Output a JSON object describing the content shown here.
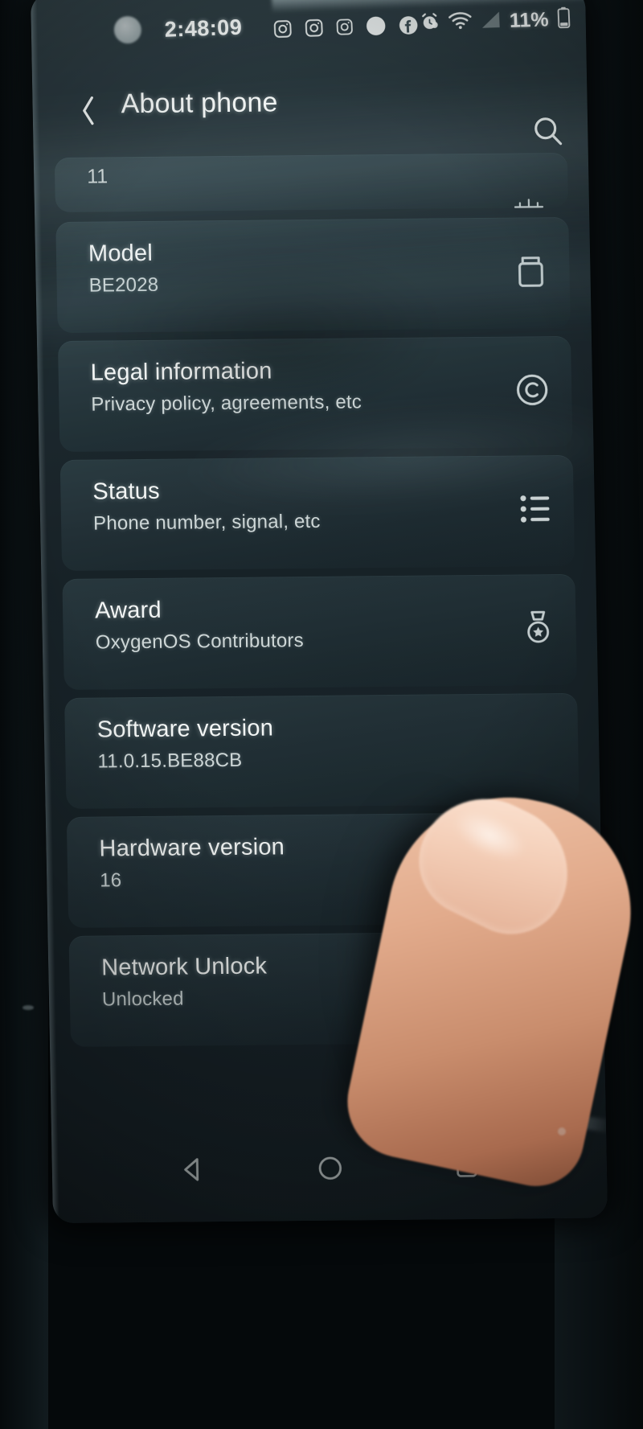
{
  "status_bar": {
    "clock": "2:48:09",
    "battery_percent": "11%",
    "notification_icons": [
      "instagram-icon",
      "instagram-icon",
      "instagram-icon",
      "snapchat-icon",
      "facebook-icon",
      "dot-icon"
    ],
    "system_icons": [
      "alarm-icon",
      "wifi-icon",
      "signal-icon",
      "battery-icon"
    ]
  },
  "app_bar": {
    "back_label": "‹",
    "title": "About phone",
    "search_label": "search"
  },
  "list": {
    "android_version_row": {
      "value": "11"
    },
    "items": [
      {
        "title": "Model",
        "subtitle": "BE2028",
        "icon": "device-box-icon"
      },
      {
        "title": "Legal information",
        "subtitle": "Privacy policy, agreements, etc",
        "icon": "copyright-icon"
      },
      {
        "title": "Status",
        "subtitle": "Phone number, signal, etc",
        "icon": "list-icon"
      },
      {
        "title": "Award",
        "subtitle": "OxygenOS Contributors",
        "icon": "medal-icon"
      },
      {
        "title": "Software version",
        "subtitle": "11.0.15.BE88CB",
        "icon": ""
      },
      {
        "title": "Hardware version",
        "subtitle": "16",
        "icon": "chip-icon"
      },
      {
        "title": "Network Unlock",
        "subtitle": "Unlocked",
        "icon": "lock-icon"
      }
    ]
  },
  "nav_bar": {
    "back": "back-triangle",
    "home": "home-circle",
    "recents": "recents-square"
  },
  "colors": {
    "screen_bg": "#162025",
    "card_bg": "#22323a",
    "text_primary": "#f2f5f4",
    "text_secondary": "#cdd6d6"
  }
}
